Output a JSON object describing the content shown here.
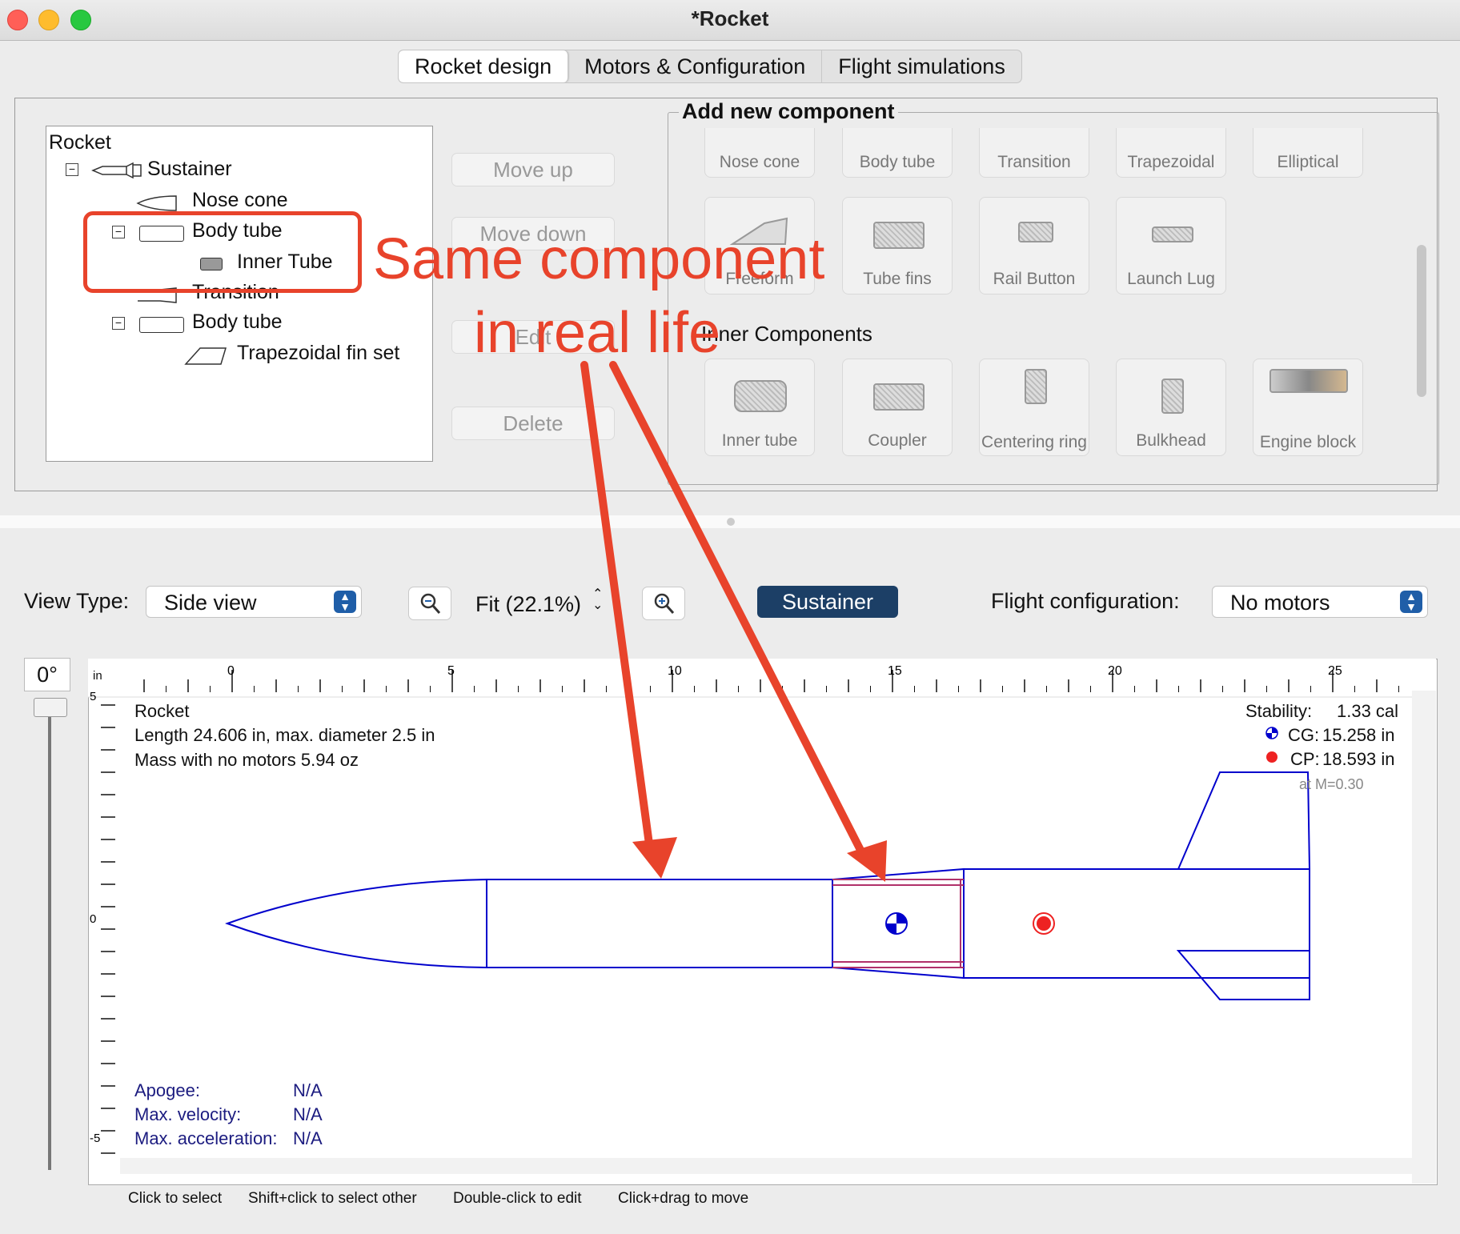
{
  "window": {
    "title": "*Rocket",
    "traffic_colors": [
      "#ff5f57",
      "#febc2e",
      "#28c840"
    ]
  },
  "tabs": [
    "Rocket design",
    "Motors & Configuration",
    "Flight simulations"
  ],
  "tree": {
    "root": "Rocket",
    "items": [
      "Sustainer",
      "Nose cone",
      "Body tube",
      "Inner Tube",
      "Transition",
      "Body tube",
      "Trapezoidal fin set"
    ]
  },
  "actions": {
    "move_up": "Move up",
    "move_down": "Move down",
    "edit": "Edit",
    "delete": "Delete"
  },
  "add_component": {
    "title": "Add new component",
    "body_components": [
      "Nose cone",
      "Body tube",
      "Transition",
      "Trapezoidal",
      "Elliptical",
      "Freeform",
      "Tube fins",
      "Rail Button",
      "Launch Lug"
    ],
    "inner_title": "Inner Components",
    "inner_components": [
      "Inner tube",
      "Coupler",
      "Centering ring",
      "Bulkhead",
      "Engine block"
    ]
  },
  "toolbar": {
    "view_type_label": "View Type:",
    "view_type_value": "Side view",
    "zoom_value": "Fit (22.1%)",
    "stage_button": "Sustainer",
    "flight_config_label": "Flight configuration:",
    "flight_config_value": "No motors"
  },
  "canvas": {
    "rotation": "0°",
    "ruler": {
      "unit": "in",
      "ticks": [
        "0",
        "5",
        "10",
        "15",
        "20",
        "25"
      ],
      "vertical_ticks": [
        "5",
        "0",
        "-5"
      ]
    },
    "info": {
      "name": "Rocket",
      "length": "Length 24.606 in, max. diameter 2.5 in",
      "mass": "Mass with no motors 5.94 oz"
    },
    "stability": {
      "label": "Stability:",
      "value": "1.33 cal",
      "cg_label": "CG:",
      "cg": "15.258 in",
      "cp_label": "CP:",
      "cp": "18.593 in",
      "mach": "at M=0.30"
    },
    "flight": {
      "apogee_label": "Apogee:",
      "apogee": "N/A",
      "velocity_label": "Max. velocity:",
      "velocity": "N/A",
      "accel_label": "Max. acceleration:",
      "accel": "N/A"
    }
  },
  "status_hints": [
    "Click to select",
    "Shift+click to select other",
    "Double-click to edit",
    "Click+drag to move"
  ],
  "annotation": {
    "line1": "Same component",
    "line2": "in real life",
    "color": "#e8432b"
  },
  "colors": {
    "rocket_line": "#0000cc",
    "inner_tube": "#b0306a",
    "cp_dot": "#ee2222",
    "accent": "#1f5ea8"
  }
}
